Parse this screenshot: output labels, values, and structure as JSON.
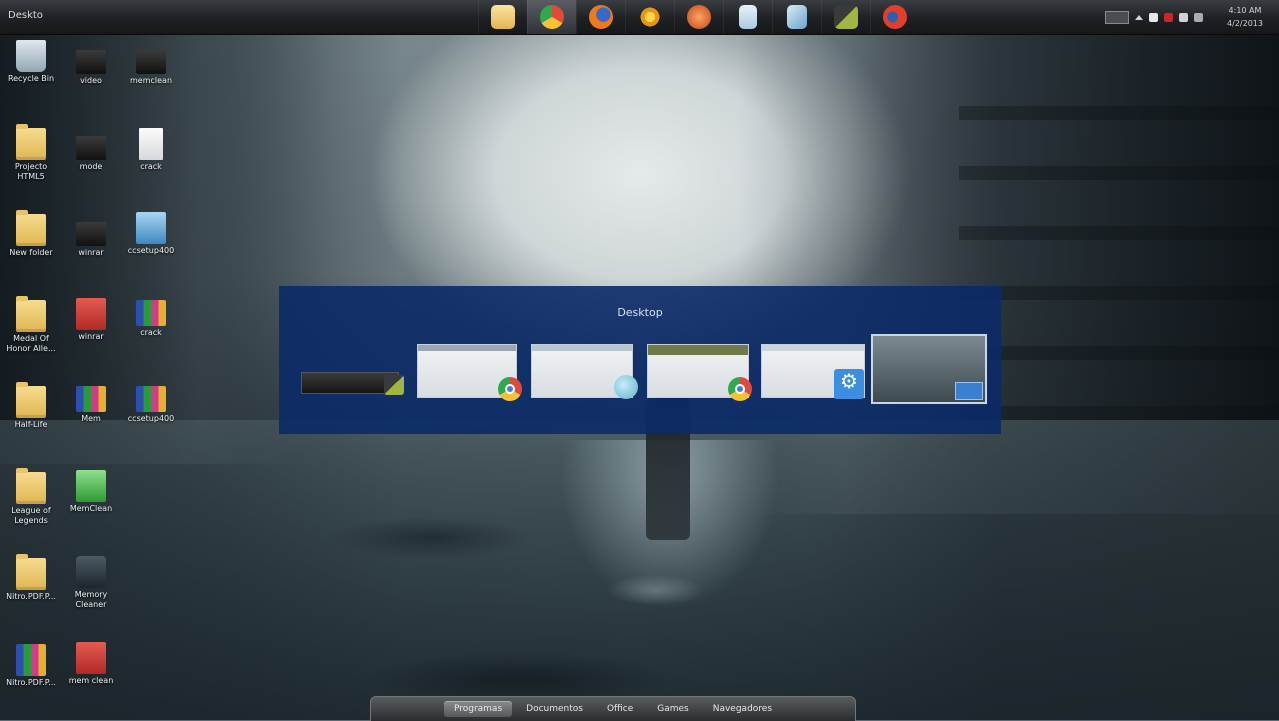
{
  "window_title": "Deskto",
  "taskbar": {
    "apps": [
      {
        "name": "explorer-icon",
        "color": "#f0c75e"
      },
      {
        "name": "chrome-icon",
        "color": "#e04a3a",
        "active": true
      },
      {
        "name": "firefox-icon",
        "color": "#f07a1a"
      },
      {
        "name": "network-icon",
        "color": "#f2b01e"
      },
      {
        "name": "media-icon",
        "color": "#d45a1f"
      },
      {
        "name": "notepad-icon",
        "color": "#cfe3f2"
      },
      {
        "name": "document-icon",
        "color": "#9cc3de"
      },
      {
        "name": "task-icon",
        "color": "#7a8a40"
      },
      {
        "name": "ccleaner-icon",
        "color": "#d8402a"
      }
    ],
    "clock_time": "4:10 AM",
    "clock_date": "4/2/2013"
  },
  "desktop_icons": [
    {
      "label": "Recycle Bin",
      "icon": "recycle-bin-icon"
    },
    {
      "label": "Projecto HTML5",
      "icon": "folder-icon"
    },
    {
      "label": "New folder",
      "icon": "folder-icon"
    },
    {
      "label": "Medal Of Honor Alle...",
      "icon": "folder-icon"
    },
    {
      "label": "Half-Life",
      "icon": "folder-icon"
    },
    {
      "label": "League of Legends",
      "icon": "folder-icon"
    },
    {
      "label": "Nitro.PDF.P...",
      "icon": "folder-icon"
    },
    {
      "label": "Nitro.PDF.P...",
      "icon": "winrar-archive-icon"
    },
    {
      "label": "video",
      "icon": "package-icon"
    },
    {
      "label": "mode",
      "icon": "package-icon"
    },
    {
      "label": "winrar",
      "icon": "package-icon"
    },
    {
      "label": "winrar",
      "icon": "red-app-icon"
    },
    {
      "label": "Mem",
      "icon": "winrar-archive-icon"
    },
    {
      "label": "MemClean",
      "icon": "green-file-icon"
    },
    {
      "label": "Memory Cleaner",
      "icon": "cleaner-icon"
    },
    {
      "label": "mem clean",
      "icon": "red-app-icon"
    },
    {
      "label": "memclean",
      "icon": "package-icon"
    },
    {
      "label": "crack",
      "icon": "blank-file-icon"
    },
    {
      "label": "ccsetup400",
      "icon": "setup-icon"
    },
    {
      "label": "crack",
      "icon": "winrar-archive-icon"
    },
    {
      "label": "ccsetup400",
      "icon": "winrar-archive-icon"
    }
  ],
  "switcher": {
    "title": "Desktop"
  },
  "dock": {
    "tabs": [
      "Programas",
      "Documentos",
      "Office",
      "Games",
      "Navegadores"
    ],
    "active": "Programas"
  }
}
